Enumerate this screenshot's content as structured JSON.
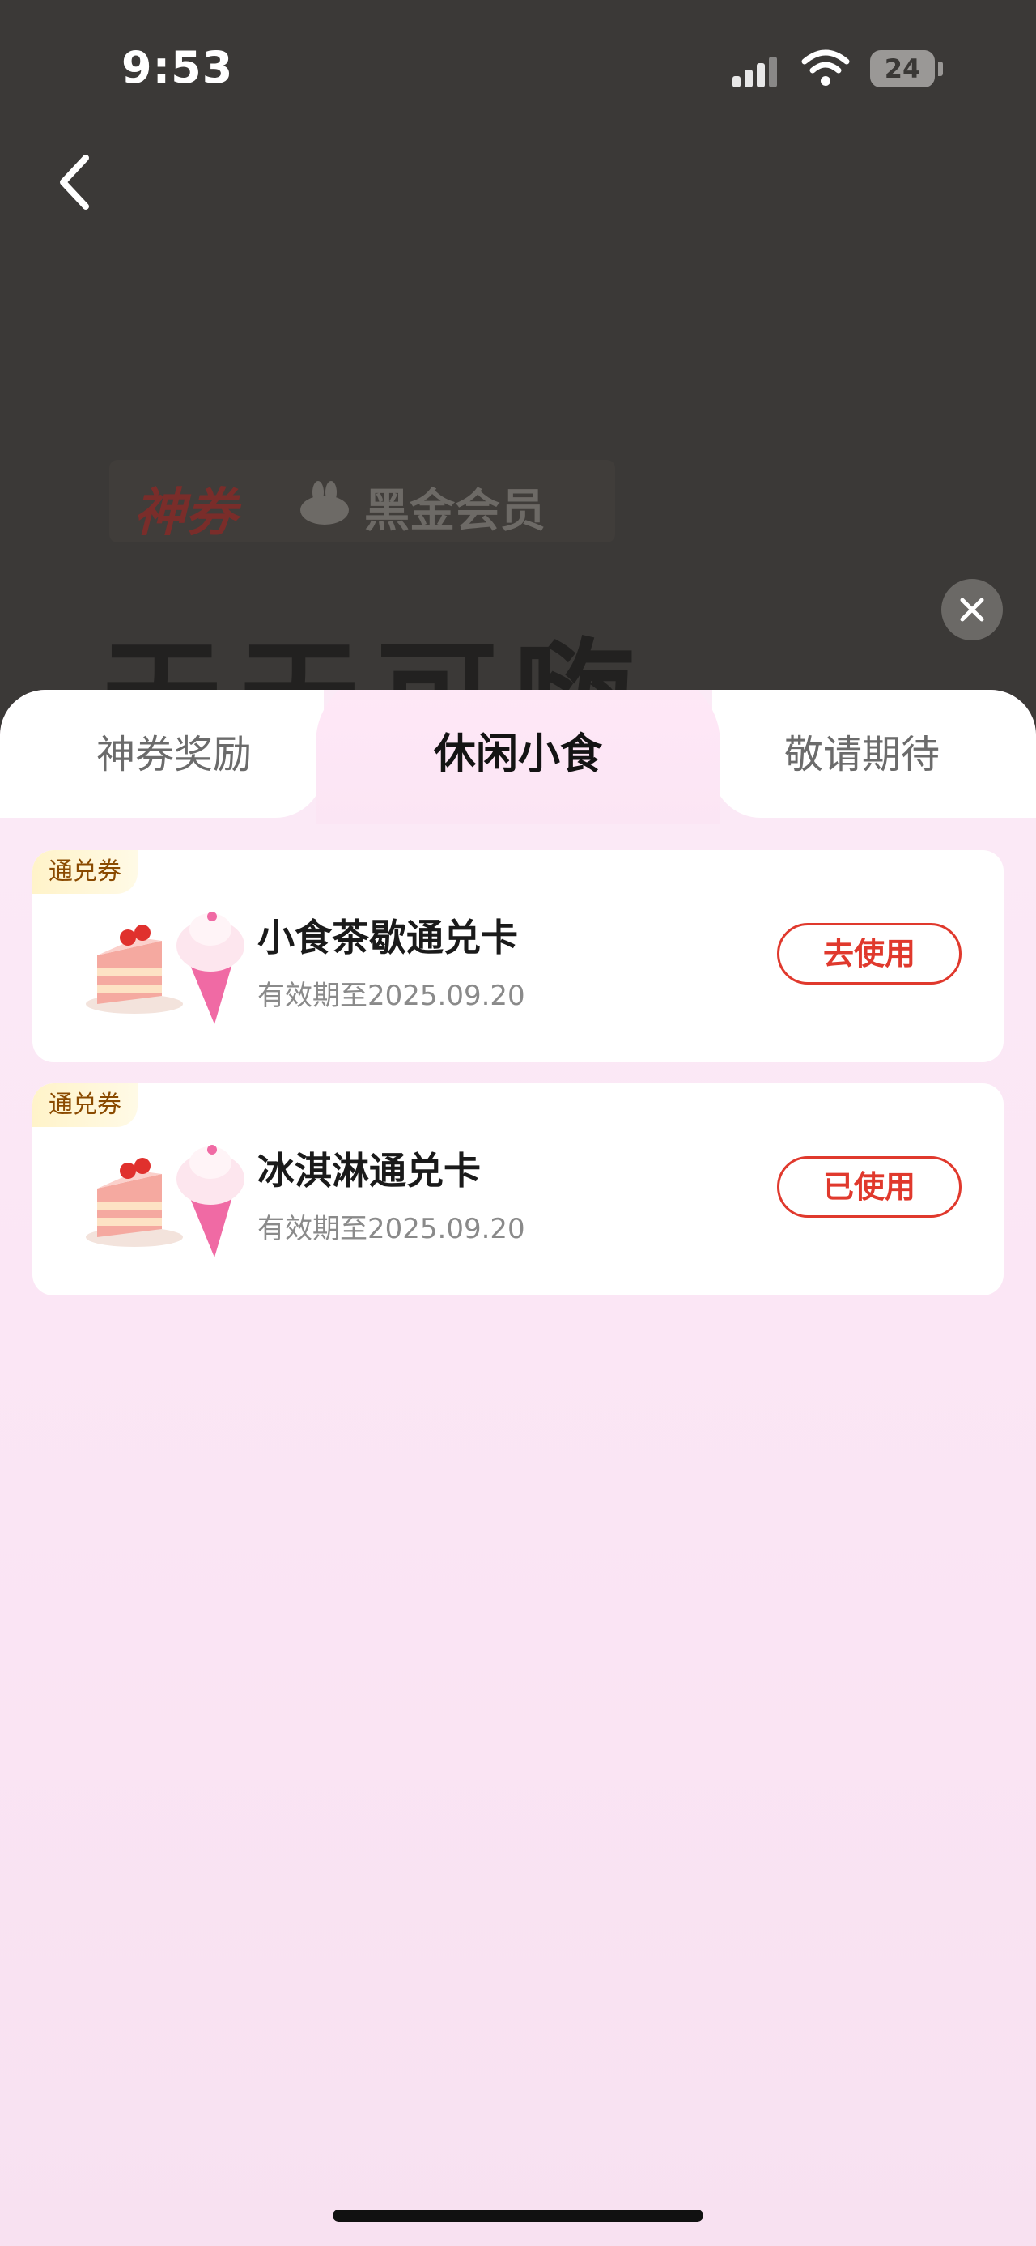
{
  "status_bar": {
    "time": "9:53",
    "battery": "24"
  },
  "background": {
    "promo_tag": "神券",
    "promo_brand": "黑金会员",
    "big_title": "天天可嗨"
  },
  "tabs": [
    {
      "label": "神券奖励",
      "active": false
    },
    {
      "label": "休闲小食",
      "active": true
    },
    {
      "label": "敬请期待",
      "active": false
    }
  ],
  "cards": [
    {
      "tag": "通兑券",
      "title": "小食茶歇通兑卡",
      "validity": "有效期至2025.09.20",
      "button": "去使用"
    },
    {
      "tag": "通兑券",
      "title": "冰淇淋通兑卡",
      "validity": "有效期至2025.09.20",
      "button": "已使用"
    }
  ],
  "colors": {
    "accent": "#e0392d",
    "sheet_bg": "#fbe6f5",
    "tag_bg": "#fff3c9"
  }
}
